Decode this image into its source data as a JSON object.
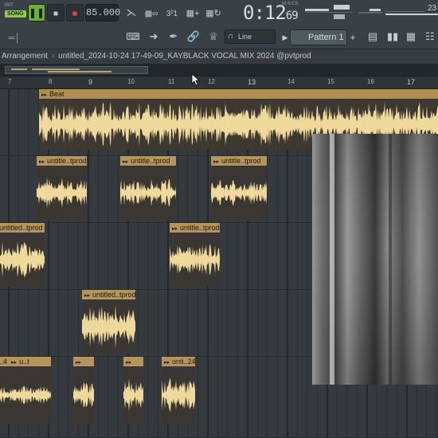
{
  "toolbar": {
    "pat_label": "PAT",
    "song_label": "SONG",
    "tempo": "85.000",
    "time_main": "0:12",
    "time_sub": "69",
    "time_unit": "M:S:CS",
    "cpu_number": "23",
    "snap_label": "Line",
    "pattern_label": "Pattern 1",
    "add_label": "+"
  },
  "breadcrumb": {
    "root": "Arrangement",
    "file": "untitled_2024-10-24 17-49-09_KAYBLACK VOCAL MIX 2024 @pvtprod"
  },
  "ruler": {
    "ticks": [
      "7",
      "8",
      "9",
      "10",
      "11",
      "12",
      "13",
      "14",
      "15",
      "16",
      "17"
    ]
  },
  "clips": {
    "beat": "Beat",
    "c1": "untitle..tprod",
    "c2": "untitle..tprod",
    "c3": "untitle..tprod",
    "c4": "untitled..tprod",
    "c5": "untitle..tprod",
    "c6": "untitled..tprod",
    "c7": "..4",
    "c7b": "u..t",
    "c8": "unti..24"
  },
  "colors": {
    "clip_header": "#b6955a",
    "waveform": "#efd99a",
    "song_mode": "#8fce3a",
    "playlist_bg": "#343a3e"
  },
  "icons": [
    "play-icon",
    "pause-icon",
    "stop-icon",
    "record-icon",
    "typing-keyboard-icon",
    "arrow-icon",
    "brush-icon",
    "link-icon",
    "stamp-icon",
    "magnet-icon",
    "mixer-icon",
    "channel-rack-icon",
    "piano-roll-icon",
    "browser-icon"
  ]
}
